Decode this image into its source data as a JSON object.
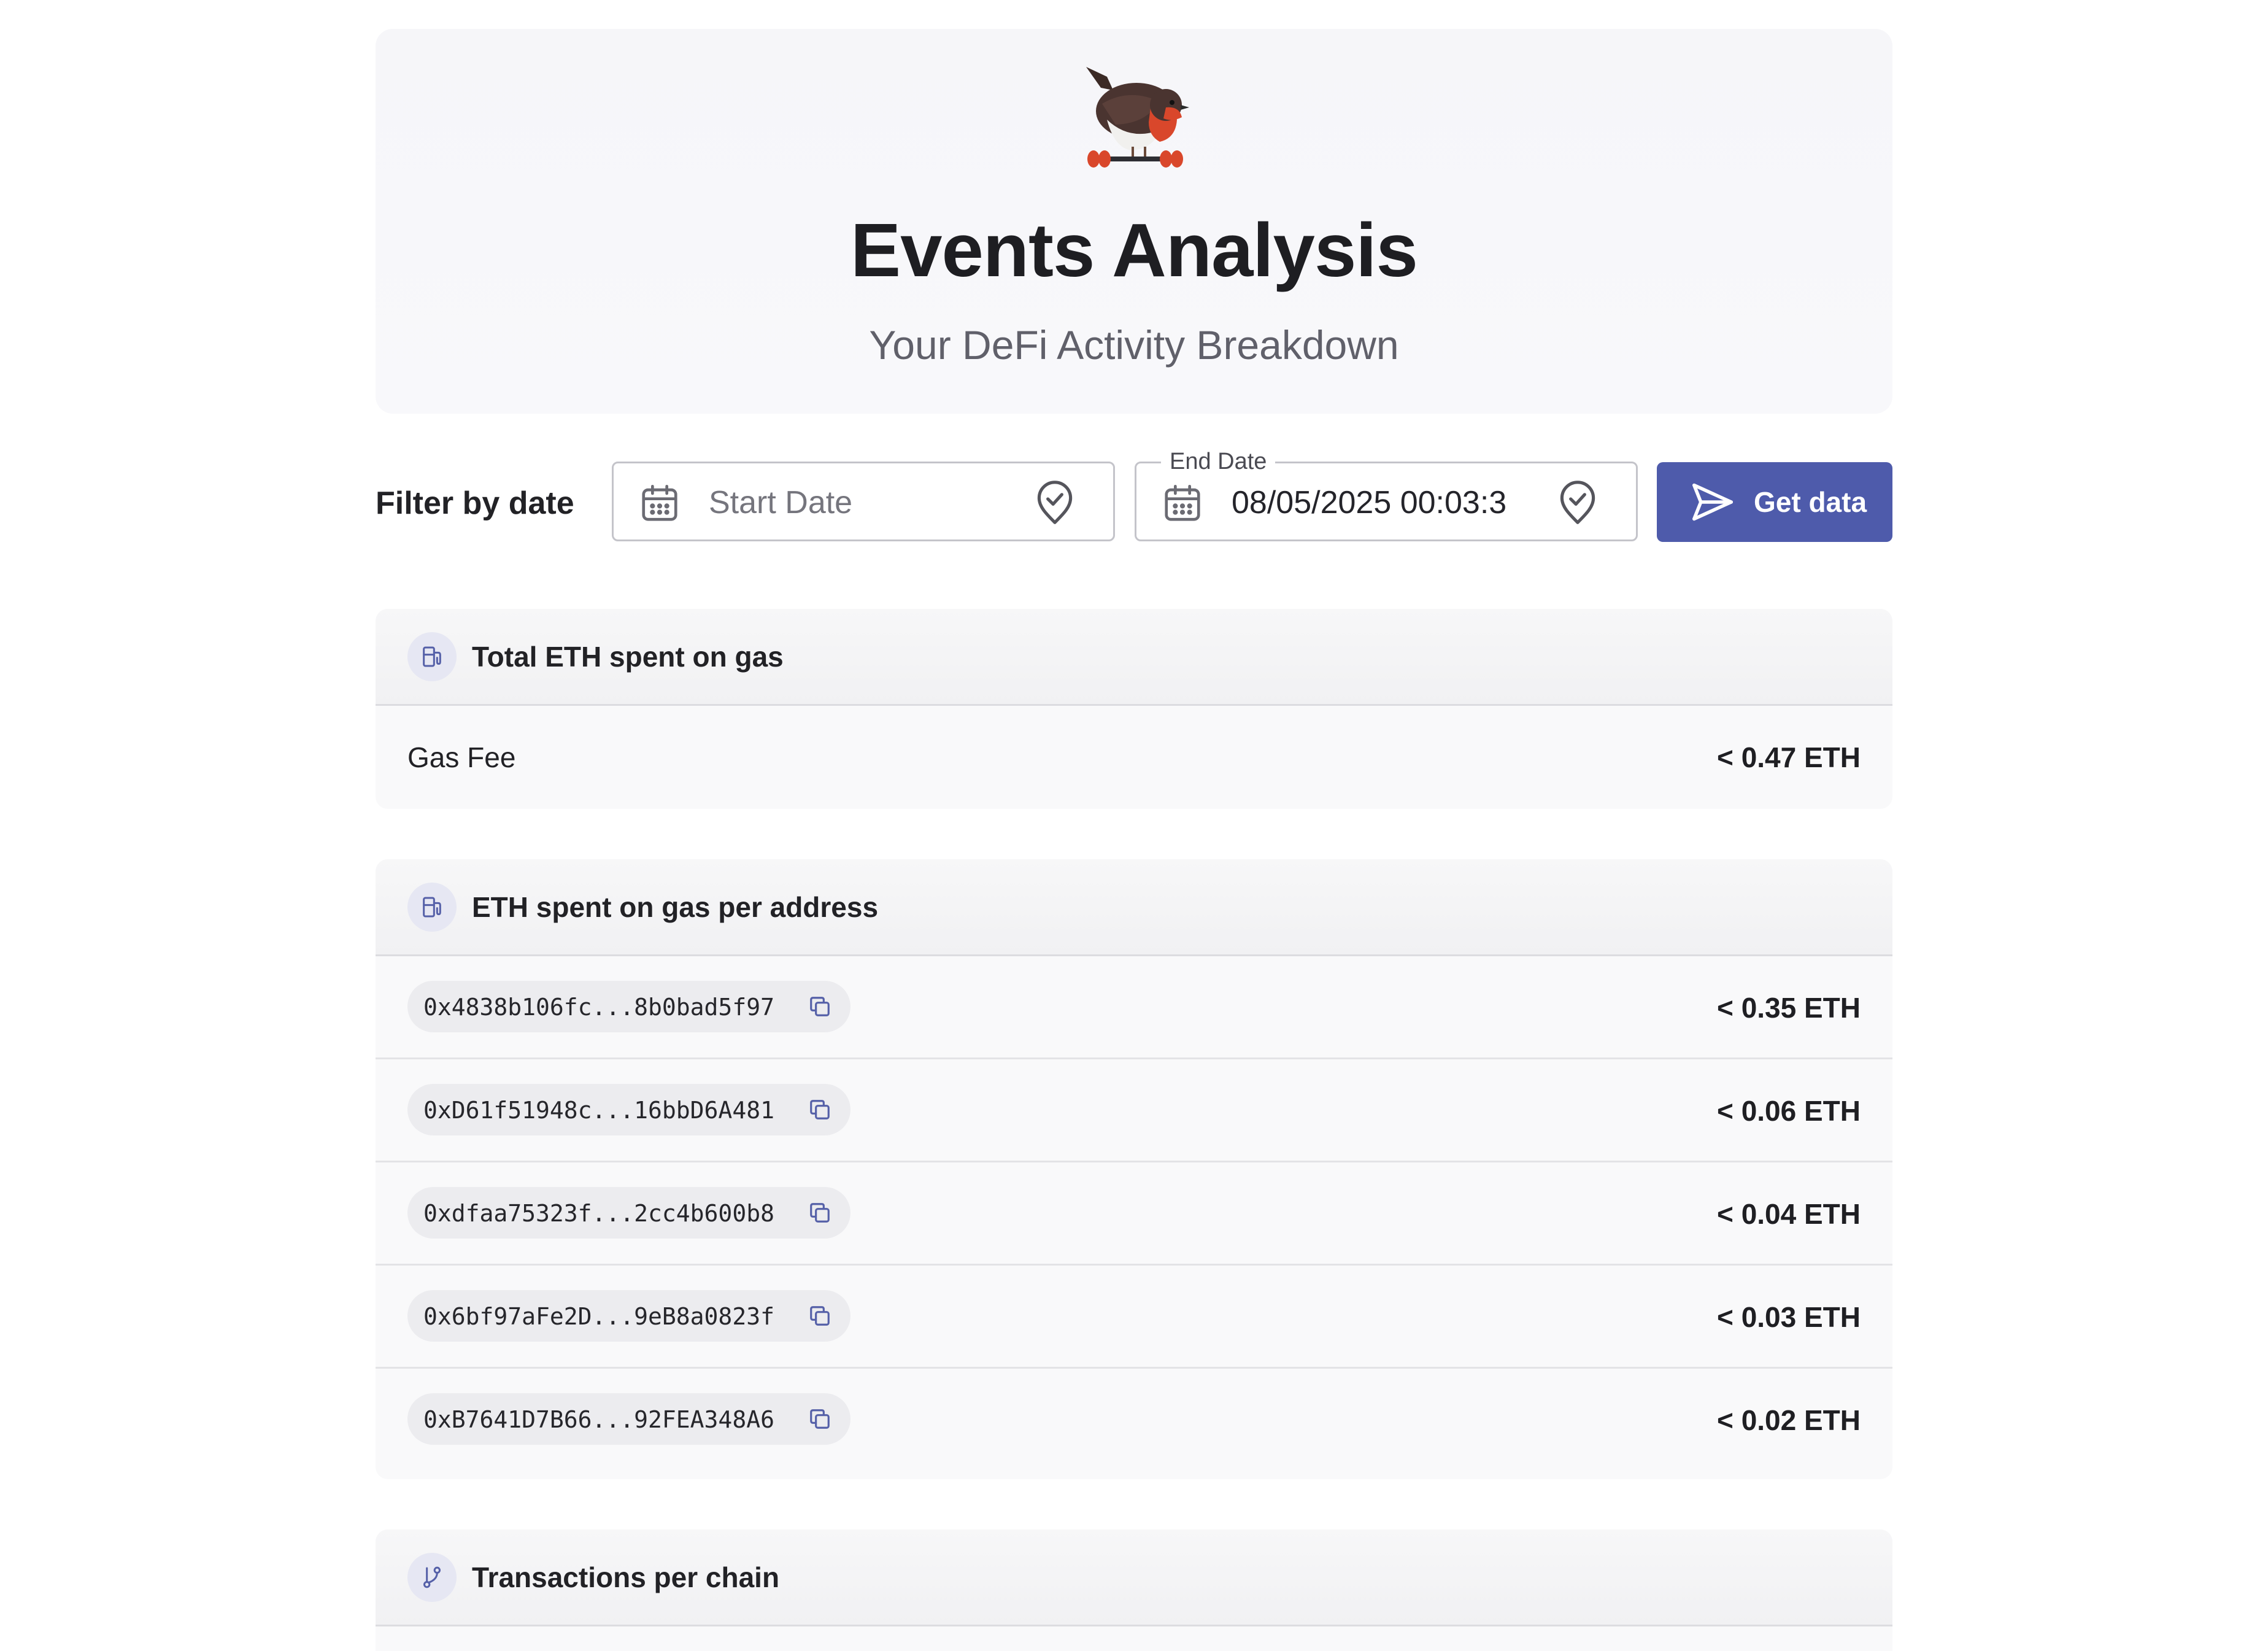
{
  "hero": {
    "logo_icon": "robin-bird-logo",
    "title": "Events Analysis",
    "subtitle": "Your DeFi Activity Breakdown"
  },
  "filter": {
    "label": "Filter by date",
    "start_date": {
      "placeholder": "Start Date",
      "value": ""
    },
    "end_date": {
      "label": "End Date",
      "value": "08/05/2025 00:03:3"
    },
    "submit_label": "Get data"
  },
  "cards": {
    "total_gas": {
      "icon": "gas-pump-icon",
      "title": "Total ETH spent on gas",
      "rows": [
        {
          "label": "Gas Fee",
          "value": "< 0.47 ETH"
        }
      ]
    },
    "gas_per_address": {
      "icon": "gas-pump-icon",
      "title": "ETH spent on gas per address",
      "rows": [
        {
          "address": "0x4838b106fc...8b0bad5f97",
          "value": "< 0.35 ETH"
        },
        {
          "address": "0xD61f51948c...16bbD6A481",
          "value": "< 0.06 ETH"
        },
        {
          "address": "0xdfaa75323f...2cc4b600b8",
          "value": "< 0.04 ETH"
        },
        {
          "address": "0x6bf97aFe2D...9eB8a0823f",
          "value": "< 0.03 ETH"
        },
        {
          "address": "0xB7641D7B66...92FEA348A6",
          "value": "< 0.02 ETH"
        }
      ]
    },
    "tx_per_chain": {
      "icon": "git-branch-icon",
      "title": "Transactions per chain"
    }
  },
  "colors": {
    "accent": "#4e5bab",
    "card_background": "#f9f9fa",
    "icon_badge": "#e6e7f3"
  }
}
